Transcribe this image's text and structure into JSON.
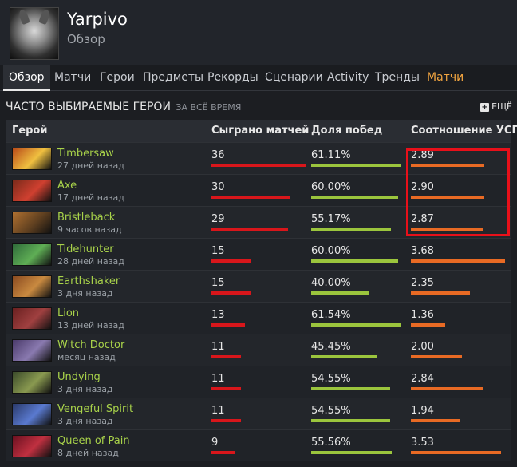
{
  "profile": {
    "name": "Yarpivo",
    "subtitle": "Обзор"
  },
  "tabs": [
    {
      "label": "Обзор",
      "active": true
    },
    {
      "label": "Матчи"
    },
    {
      "label": "Герои"
    },
    {
      "label": "Предметы"
    },
    {
      "label": "Рекорды"
    },
    {
      "label": "Сценарии"
    },
    {
      "label": "Activity"
    },
    {
      "label": "Тренды"
    },
    {
      "label": "Матчи",
      "accent": true
    }
  ],
  "section": {
    "title": "ЧАСТО ВЫБИРАЕМЫЕ ГЕРОИ",
    "subtitle": "ЗА ВСЁ ВРЕМЯ",
    "more_label": "ЕЩЁ"
  },
  "columns": [
    "Герой",
    "Сыграно матчей",
    "Доля побед",
    "Соотношение УСП"
  ],
  "colors": {
    "hero_name": "#a9d34a",
    "matches_bar": "#d8161b",
    "winrate_bar": "#9bc53d",
    "kda_bar": "#e86a24",
    "highlight": "#e8101a",
    "accent_tab": "#f2a540"
  },
  "rows": [
    {
      "hero": "Timbersaw",
      "time": "27 дней назад",
      "matches": "36",
      "winrate": "61.11%",
      "kda": "2.89",
      "matches_level": 1.0,
      "winrate_level": 0.98,
      "kda_level": 0.77,
      "icon": "timbersaw-portrait"
    },
    {
      "hero": "Axe",
      "time": "17 дней назад",
      "matches": "30",
      "winrate": "60.00%",
      "kda": "2.90",
      "matches_level": 0.83,
      "winrate_level": 0.96,
      "kda_level": 0.77,
      "icon": "axe-portrait"
    },
    {
      "hero": "Bristleback",
      "time": "9 часов назад",
      "matches": "29",
      "winrate": "55.17%",
      "kda": "2.87",
      "matches_level": 0.81,
      "winrate_level": 0.88,
      "kda_level": 0.76,
      "icon": "bristleback-portrait"
    },
    {
      "hero": "Tidehunter",
      "time": "28 дней назад",
      "matches": "15",
      "winrate": "60.00%",
      "kda": "3.68",
      "matches_level": 0.42,
      "winrate_level": 0.96,
      "kda_level": 0.98,
      "icon": "tidehunter-portrait"
    },
    {
      "hero": "Earthshaker",
      "time": "3 дня назад",
      "matches": "15",
      "winrate": "40.00%",
      "kda": "2.35",
      "matches_level": 0.42,
      "winrate_level": 0.64,
      "kda_level": 0.62,
      "icon": "earthshaker-portrait"
    },
    {
      "hero": "Lion",
      "time": "13 дней назад",
      "matches": "13",
      "winrate": "61.54%",
      "kda": "1.36",
      "matches_level": 0.36,
      "winrate_level": 0.98,
      "kda_level": 0.36,
      "icon": "lion-portrait"
    },
    {
      "hero": "Witch Doctor",
      "time": "месяц назад",
      "matches": "11",
      "winrate": "45.45%",
      "kda": "2.00",
      "matches_level": 0.31,
      "winrate_level": 0.72,
      "kda_level": 0.53,
      "icon": "witch-doctor-portrait"
    },
    {
      "hero": "Undying",
      "time": "3 дня назад",
      "matches": "11",
      "winrate": "54.55%",
      "kda": "2.84",
      "matches_level": 0.31,
      "winrate_level": 0.87,
      "kda_level": 0.76,
      "icon": "undying-portrait"
    },
    {
      "hero": "Vengeful Spirit",
      "time": "3 дня назад",
      "matches": "11",
      "winrate": "54.55%",
      "kda": "1.94",
      "matches_level": 0.31,
      "winrate_level": 0.87,
      "kda_level": 0.52,
      "icon": "vengeful-spirit-portrait"
    },
    {
      "hero": "Queen of Pain",
      "time": "8 дней назад",
      "matches": "9",
      "winrate": "55.56%",
      "kda": "3.53",
      "matches_level": 0.25,
      "winrate_level": 0.89,
      "kda_level": 0.94,
      "icon": "queen-of-pain-portrait"
    }
  ]
}
